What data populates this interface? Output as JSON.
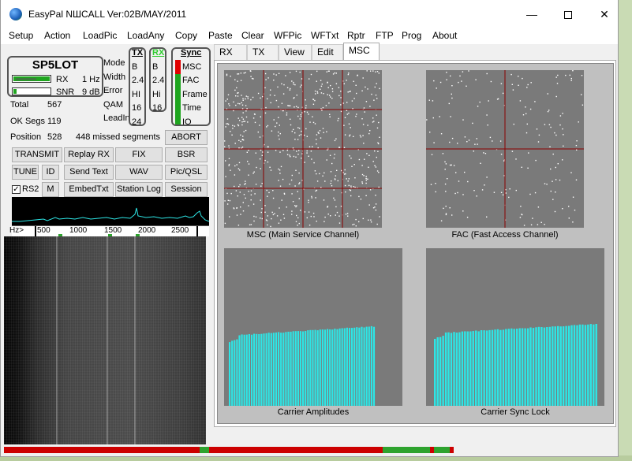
{
  "window": {
    "title": "EasyPal  NШCALL   Ver:02B/MAY/2011"
  },
  "menu": [
    "Setup",
    "Action",
    "LoadPic",
    "LoadAny",
    "Copy",
    "Paste",
    "Clear",
    "WFPic",
    "WFTxt",
    "Rptr",
    "FTP",
    "Prog",
    "About"
  ],
  "status": {
    "callsign": "SP5LOT",
    "rx_label": "RX",
    "rx_value": "1 Hz",
    "snr_label": "SNR",
    "snr_value": "9 dB",
    "total_label": "Total",
    "total_value": "567",
    "ok_segs_label": "OK Segs",
    "ok_segs_value": "119",
    "position_label": "Position",
    "position_value": "528",
    "missed_text": "448  missed segments"
  },
  "params": {
    "labels": [
      "Mode",
      "Width",
      "Error",
      "QAM",
      "LeadIn"
    ],
    "tx_header": "TX",
    "tx_values": [
      "B",
      "2.4",
      "HI",
      "16",
      "24"
    ],
    "rx_header": "RX",
    "rx_values": [
      "B",
      "2.4",
      "Hi",
      "16"
    ],
    "sync_header": "Sync",
    "sync_items": [
      "MSC",
      "FAC",
      "Frame",
      "Time",
      "IO"
    ]
  },
  "buttons": {
    "abort": "ABORT",
    "transmit": "TRANSMIT",
    "replay_rx": "Replay RX",
    "fix": "FIX",
    "bsr": "BSR",
    "tune": "TUNE",
    "id": "ID",
    "send_text": "Send Text",
    "wav": "WAV",
    "pic_qsl": "Pic/QSL",
    "rs2": "RS2",
    "m": "M",
    "embed_txt": "EmbedTxt",
    "station_log": "Station Log",
    "session": "Session"
  },
  "spectrum_scale": {
    "hz_label": "Hz>",
    "ticks": [
      "500",
      "1000",
      "1500",
      "2000",
      "2500"
    ]
  },
  "tabs": [
    "RX",
    "TX",
    "View",
    "Edit",
    "MSC"
  ],
  "plots": {
    "msc_caption": "MSC (Main Service Channel)",
    "fac_caption": "FAC (Fast Access Channel)",
    "amplitude_caption": "Carrier Amplitudes",
    "sync_caption": "Carrier Sync Lock"
  },
  "colors": {
    "plot_bg": "#7a7a7a",
    "bars": "#2de6e6",
    "grid": "#8b0000",
    "sync_green": "#1fa51f",
    "sync_red": "#e00000"
  }
}
